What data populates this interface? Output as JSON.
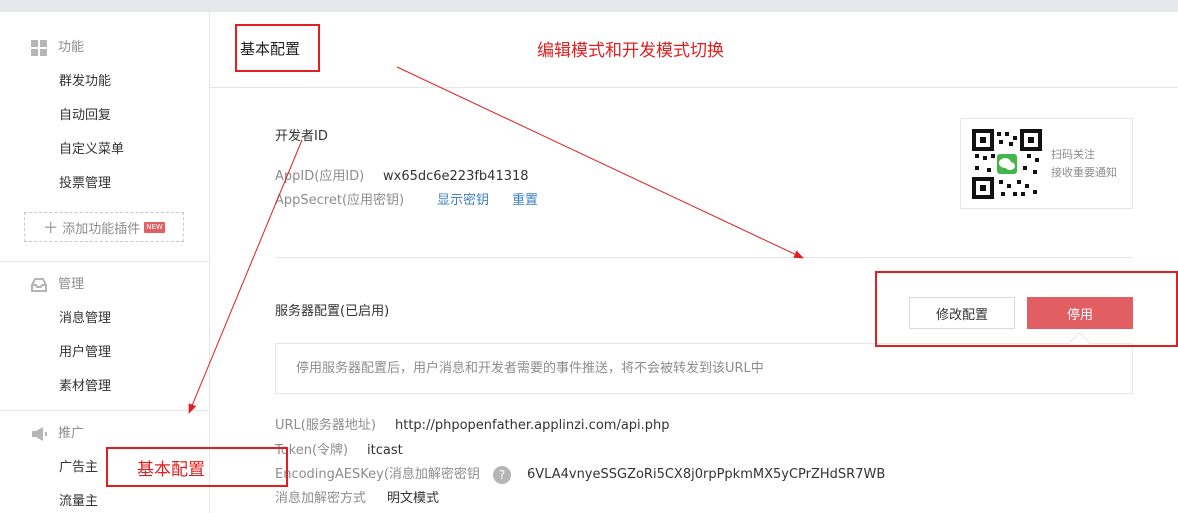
{
  "sidebar": {
    "groups": [
      {
        "title": "功能",
        "icon": "grid-icon",
        "items": [
          "群发功能",
          "自动回复",
          "自定义菜单",
          "投票管理"
        ]
      },
      {
        "title": "管理",
        "icon": "inbox-icon",
        "items": [
          "消息管理",
          "用户管理",
          "素材管理"
        ]
      },
      {
        "title": "推广",
        "icon": "megaphone-icon",
        "items": [
          "广告主",
          "流量主"
        ]
      }
    ],
    "add_plugin": {
      "label": "添加功能插件",
      "badge": "NEW"
    }
  },
  "header": {
    "title": "基本配置"
  },
  "developer": {
    "section_title": "开发者ID",
    "appid_label": "AppID(应用ID)",
    "appid_value": "wx65dc6e223fb41318",
    "secret_label": "AppSecret(应用密钥)",
    "show_secret_link": "显示密钥",
    "reset_link": "重置"
  },
  "qr": {
    "line1": "扫码关注",
    "line2": "接收重要通知"
  },
  "server": {
    "section_title": "服务器配置(已启用)",
    "edit_button": "修改配置",
    "stop_button": "停用",
    "tip": "停用服务器配置后，用户消息和开发者需要的事件推送，将不会被转发到该URL中",
    "url_label": "URL(服务器地址)",
    "url_value": "http://phpopenfather.applinzi.com/api.php",
    "token_label": "Token(令牌)",
    "token_value": "itcast",
    "aes_label": "EncodingAESKey(消息加解密密钥",
    "aes_value": "6VLA4vnyeSSGZoRi5CX8j0rpPpkmMX5yCPrZHdSR7WB",
    "mode_label": "消息加解密方式",
    "mode_value": "明文模式"
  },
  "annotations": {
    "top_note": "编辑模式和开发模式切换",
    "sidebar_note": "基本配置",
    "color": "#e02020"
  },
  "colors": {
    "accent_red": "#e15f63",
    "link_blue": "#3f7fc6"
  }
}
